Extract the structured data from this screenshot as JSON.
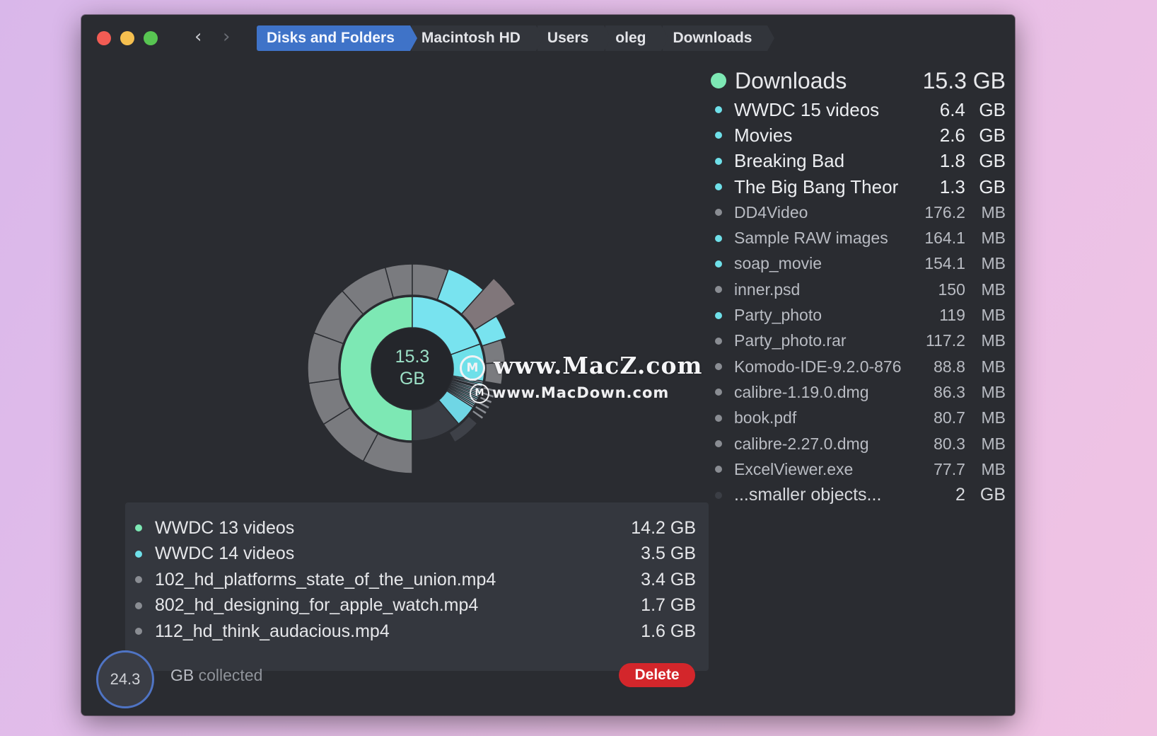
{
  "breadcrumb": [
    "Disks and Folders",
    "Macintosh HD",
    "Users",
    "oleg",
    "Downloads"
  ],
  "folder": {
    "name": "Downloads",
    "size": "15.3 GB",
    "color": "#7de8b4"
  },
  "items": [
    {
      "name": "WWDC 15 videos",
      "num": "6.4",
      "unit": "GB",
      "color": "#6fe0e9",
      "style": "big"
    },
    {
      "name": "Movies",
      "num": "2.6",
      "unit": "GB",
      "color": "#6fe0e9",
      "style": "big"
    },
    {
      "name": "Breaking Bad",
      "num": "1.8",
      "unit": "GB",
      "color": "#6fe0e9",
      "style": "big"
    },
    {
      "name": "The Big Bang Theor",
      "num": "1.3",
      "unit": "GB",
      "color": "#6fe0e9",
      "style": "big"
    },
    {
      "name": "DD4Video",
      "num": "176.2",
      "unit": "MB",
      "color": "#8a8d93",
      "style": "small"
    },
    {
      "name": "Sample RAW images",
      "num": "164.1",
      "unit": "MB",
      "color": "#6fe0e9",
      "style": "small"
    },
    {
      "name": "soap_movie",
      "num": "154.1",
      "unit": "MB",
      "color": "#6fe0e9",
      "style": "small"
    },
    {
      "name": "inner.psd",
      "num": "150",
      "unit": "MB",
      "color": "#8a8d93",
      "style": "small"
    },
    {
      "name": "Party_photo",
      "num": "119",
      "unit": "MB",
      "color": "#6fe0e9",
      "style": "small"
    },
    {
      "name": "Party_photo.rar",
      "num": "117.2",
      "unit": "MB",
      "color": "#8a8d93",
      "style": "small"
    },
    {
      "name": "Komodo-IDE-9.2.0-876",
      "num": "88.8",
      "unit": "MB",
      "color": "#8a8d93",
      "style": "small"
    },
    {
      "name": "calibre-1.19.0.dmg",
      "num": "86.3",
      "unit": "MB",
      "color": "#8a8d93",
      "style": "small"
    },
    {
      "name": "book.pdf",
      "num": "80.7",
      "unit": "MB",
      "color": "#8a8d93",
      "style": "small"
    },
    {
      "name": "calibre-2.27.0.dmg",
      "num": "80.3",
      "unit": "MB",
      "color": "#8a8d93",
      "style": "small"
    },
    {
      "name": "ExcelViewer.exe",
      "num": "77.7",
      "unit": "MB",
      "color": "#8a8d93",
      "style": "small"
    },
    {
      "name": "...smaller objects...",
      "num": "2",
      "unit": "GB",
      "color": "#3b3e45",
      "style": "smaller"
    }
  ],
  "chart_center": {
    "line1": "15.3",
    "line2": "GB"
  },
  "collected_list": [
    {
      "name": "WWDC 13 videos",
      "size": "14.2 GB",
      "color": "#7de8b4"
    },
    {
      "name": "WWDC 14 videos",
      "size": "3.5 GB",
      "color": "#6fe0e9"
    },
    {
      "name": "102_hd_platforms_state_of_the_union.mp4",
      "size": "3.4 GB",
      "color": "#8a8d93"
    },
    {
      "name": "802_hd_designing_for_apple_watch.mp4",
      "size": "1.7 GB",
      "color": "#8a8d93"
    },
    {
      "name": "112_hd_think_audacious.mp4",
      "size": "1.6 GB",
      "color": "#8a8d93"
    }
  ],
  "collected": {
    "value": "24.3",
    "unit": "GB",
    "text": " collected"
  },
  "delete_label": "Delete",
  "watermark": {
    "line1": "www.MacZ.com",
    "line2": "www.MacDown.com",
    "logo": "M"
  },
  "icons": {
    "back": "chevron-left-icon",
    "forward": "chevron-right-icon"
  }
}
